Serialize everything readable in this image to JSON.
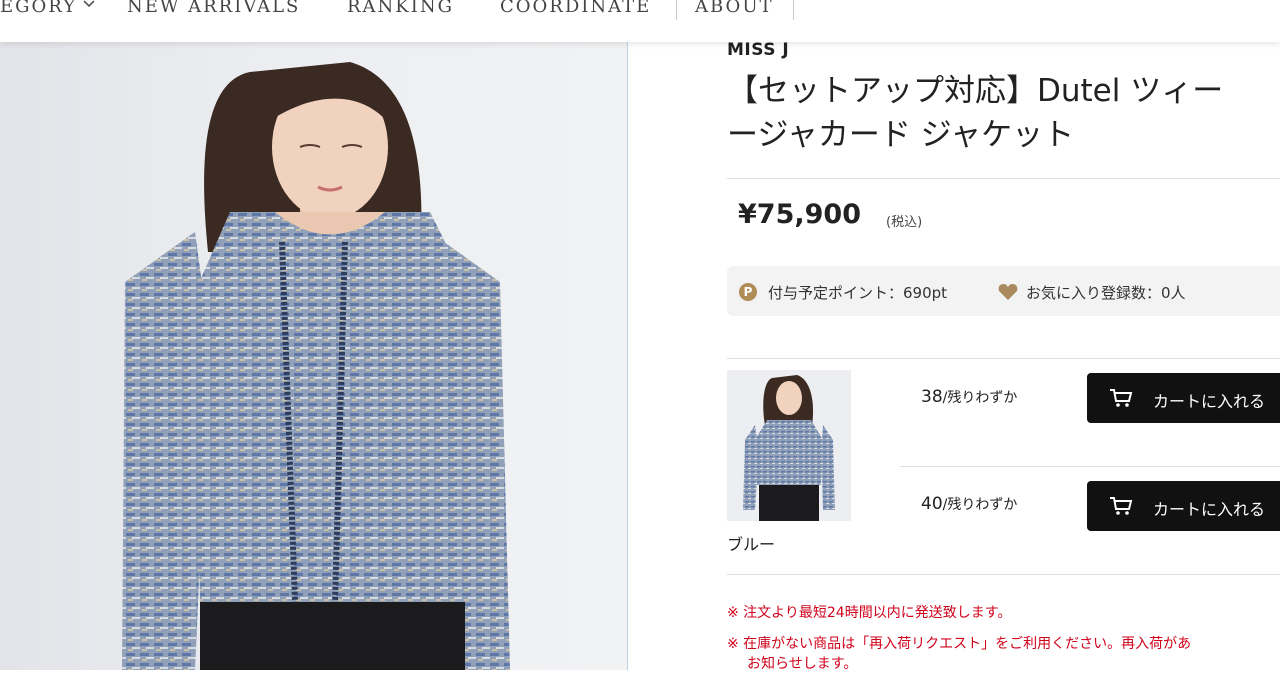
{
  "nav": {
    "items": [
      {
        "label": "EGORY",
        "has_chevron": true
      },
      {
        "label": "NEW ARRIVALS"
      },
      {
        "label": "RANKING"
      },
      {
        "label": "COORDINATE"
      },
      {
        "label": "ABOUT"
      }
    ]
  },
  "product": {
    "brand": "MISS J",
    "title_line1": "【セットアップ対応】Dutel ツィー",
    "title_line2": "ージャカード ジャケット",
    "price": "¥75,900",
    "tax_note": "(税込)",
    "points_icon": "P",
    "points_text": "付与予定ポイント：690pt",
    "favorites_text": "お気に入り登録数：0人",
    "color_name": "ブルー",
    "variants": [
      {
        "size": "38",
        "stock": "/残りわずか",
        "cart_label": "カートに入れる"
      },
      {
        "size": "40",
        "stock": "/残りわずか",
        "cart_label": "カートに入れる"
      }
    ]
  },
  "notes": [
    "※ 注文より最短24時間以内に発送致します。",
    "※ 在庫がない商品は「再入荷リクエスト」をご利用ください。再入荷があ",
    "お知らせします。"
  ],
  "colors": {
    "accent_gold": "#b08d57",
    "button_black": "#111111",
    "notice_red": "#d0021b"
  },
  "icons": [
    "chevron-down-icon",
    "points-icon",
    "heart-icon",
    "cart-icon"
  ]
}
